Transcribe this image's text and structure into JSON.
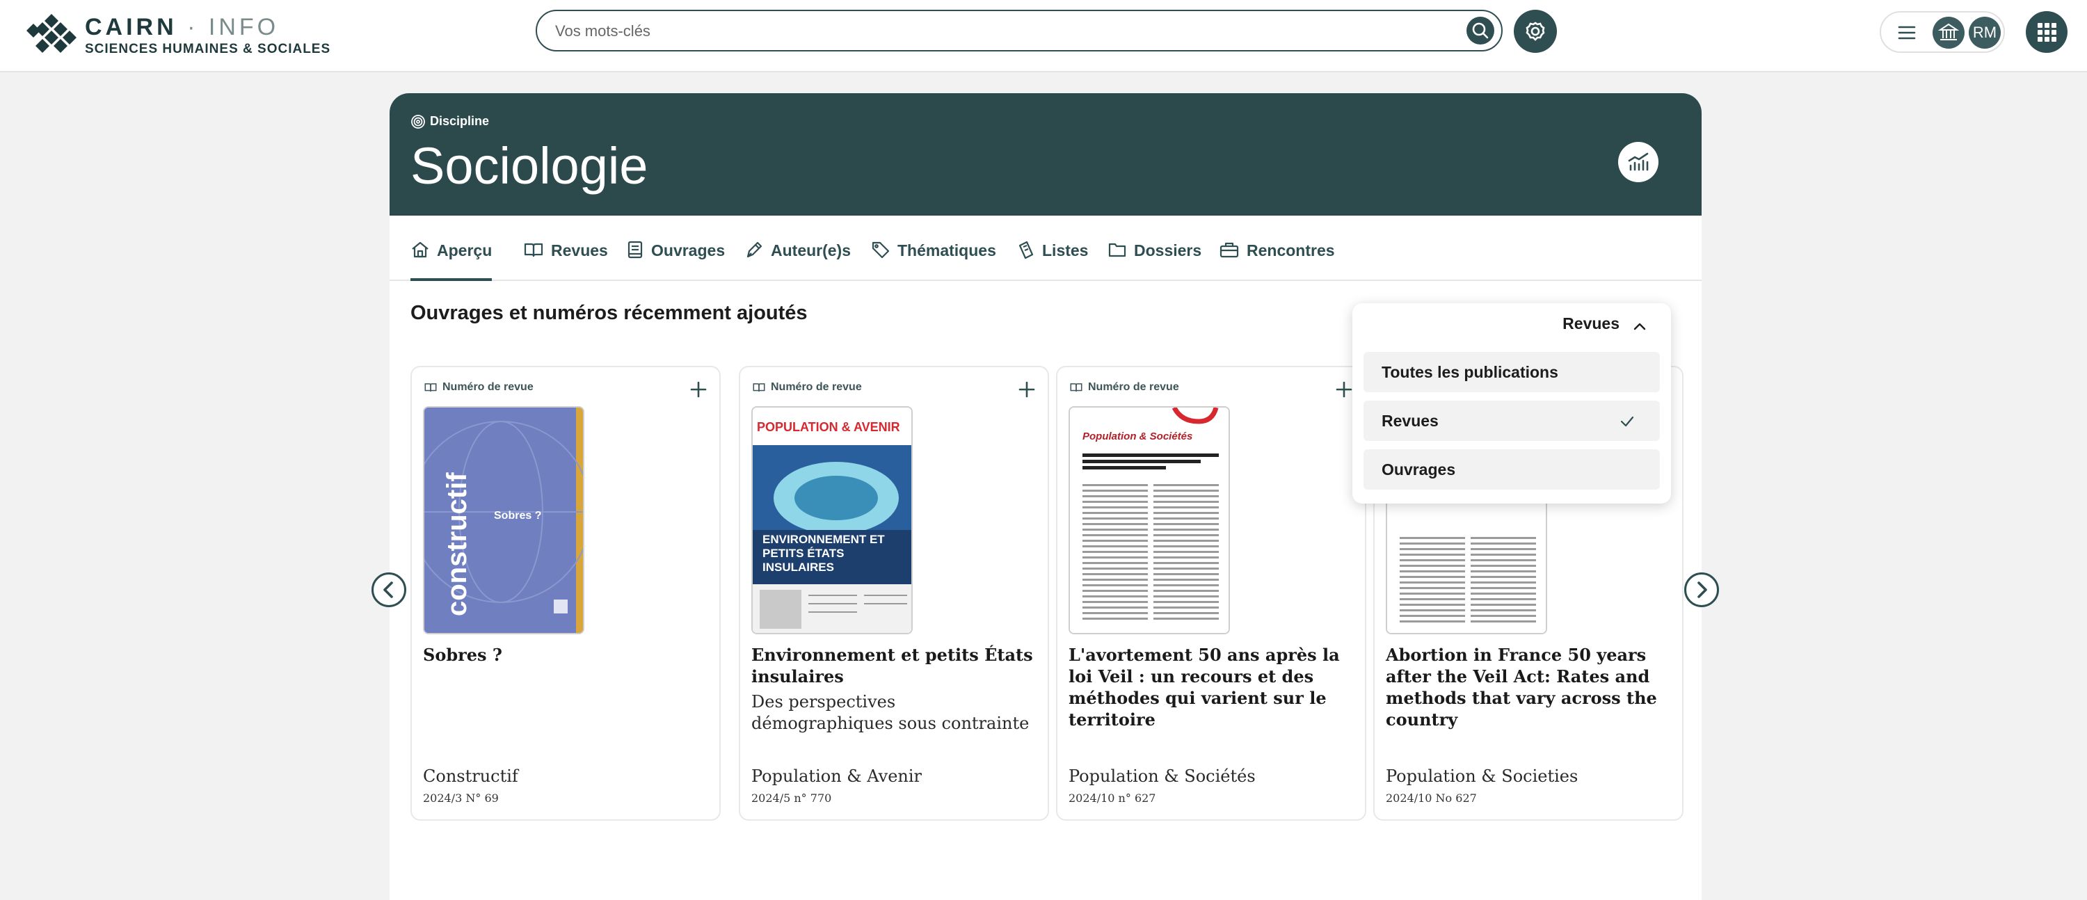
{
  "header": {
    "logo_title": "CAIRN",
    "logo_dot": "·",
    "logo_info": "INFO",
    "logo_subtitle": "SCIENCES HUMAINES & SOCIALES",
    "search_placeholder": "Vos mots-clés",
    "avatar_initials": "RM"
  },
  "hero": {
    "kicker": "Discipline",
    "title": "Sociologie",
    "background_color": "#2c4a4c"
  },
  "tabs": [
    {
      "label": "Aperçu",
      "icon": "home-icon",
      "active": true
    },
    {
      "label": "Revues",
      "icon": "open-book-icon"
    },
    {
      "label": "Ouvrages",
      "icon": "book-icon"
    },
    {
      "label": "Auteur(e)s",
      "icon": "pen-icon"
    },
    {
      "label": "Thématiques",
      "icon": "tag-icon"
    },
    {
      "label": "Listes",
      "icon": "list-icon"
    },
    {
      "label": "Dossiers",
      "icon": "folder-icon"
    },
    {
      "label": "Rencontres",
      "icon": "meeting-icon"
    }
  ],
  "section": {
    "title": "Ouvrages et numéros récemment ajoutés"
  },
  "filter": {
    "selected": "Revues",
    "options": [
      {
        "label": "Toutes les publications",
        "checked": false
      },
      {
        "label": "Revues",
        "checked": true
      },
      {
        "label": "Ouvrages",
        "checked": false
      }
    ]
  },
  "cards": [
    {
      "kicker": "Numéro de revue",
      "title": "Sobres ?",
      "subtitle": "",
      "journal": "Constructif",
      "issue": "2024/3 N° 69",
      "cover_text": "Sobres ?",
      "cover_brand": "constructif"
    },
    {
      "kicker": "Numéro de revue",
      "title": "Environnement et petits États insulaires",
      "subtitle": "Des perspectives démographiques sous contrainte",
      "journal": "Population & Avenir",
      "issue": "2024/5 n° 770",
      "cover_brand": "POPULATION & AVENIR",
      "cover_text": "ENVIRONNEMENT ET PETITS ÉTATS INSULAIRES"
    },
    {
      "kicker": "Numéro de revue",
      "title": "L'avortement 50 ans après la loi Veil : un recours et des méthodes qui varient sur le territoire",
      "subtitle": "",
      "journal": "Population & Sociétés",
      "issue": "2024/10 n° 627",
      "cover_brand": "Population & Sociétés"
    },
    {
      "kicker": "Numéro de revue",
      "title": "Abortion in France 50 years after the Veil Act: Rates and methods that vary across the country",
      "subtitle": "",
      "journal": "Population & Societies",
      "issue": "2024/10 No 627"
    }
  ],
  "pagination": {
    "count": 5,
    "active": 1
  },
  "colors": {
    "accent": "#2f4e52",
    "cover_blue": "#6f7fc0",
    "cover_gold": "#d9a63b",
    "pop_red": "#d7282f"
  }
}
